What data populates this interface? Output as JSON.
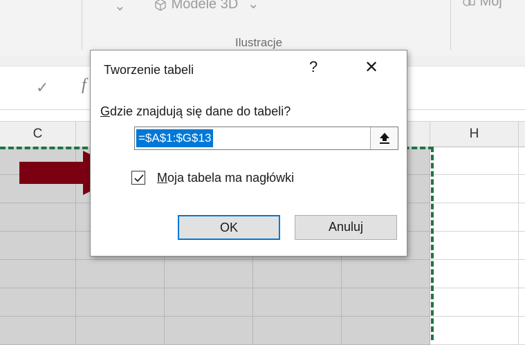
{
  "ribbon": {
    "chevron": "⌄",
    "models_3d_label": "Modele 3D",
    "models_3d_caret": "⌄",
    "group_label": "Ilustracje",
    "right_item_label": "Moj"
  },
  "formula_bar": {
    "confirm_icon": "check-icon",
    "fx_label": "f"
  },
  "columns": {
    "c": "C",
    "h": "H"
  },
  "dialog": {
    "title": "Tworzenie tabeli",
    "help": "?",
    "close": "✕",
    "question_accel": "G",
    "question_rest": "dzie znajdują się dane do tabeli?",
    "range_value": "=$A$1:$G$13",
    "checkbox_accel": "M",
    "checkbox_rest": "oja tabela ma nagłówki",
    "checkbox_checked": true,
    "ok_label": "OK",
    "cancel_label": "Anuluj"
  },
  "annotation": {
    "arrow_color": "#7b0012"
  },
  "colors": {
    "selection_marquee": "#217346",
    "range_highlight": "#0078d7",
    "selected_cells": "#d2d2d2"
  }
}
